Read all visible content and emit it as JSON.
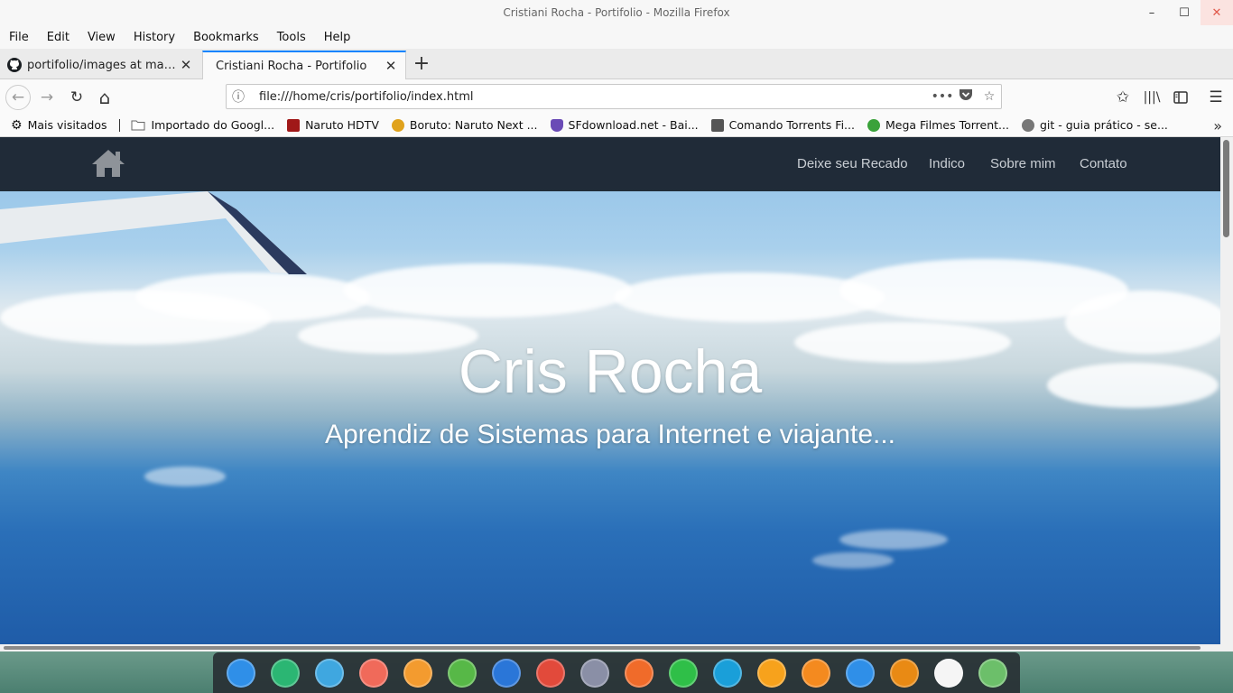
{
  "window": {
    "title": "Cristiani Rocha - Portifolio - Mozilla Firefox",
    "minimize_glyph": "–",
    "maximize_glyph": "☐",
    "close_glyph": "✕"
  },
  "menu": [
    "File",
    "Edit",
    "View",
    "History",
    "Bookmarks",
    "Tools",
    "Help"
  ],
  "tabs": [
    {
      "label": "portifolio/images at master · (",
      "icon": "github-icon",
      "active": false
    },
    {
      "label": "Cristiani Rocha - Portifolio",
      "icon": "",
      "active": true
    }
  ],
  "toolbar": {
    "url": "file:///home/cris/portifolio/index.html",
    "more_glyph": "•••",
    "back_glyph": "←",
    "forward_glyph": "→",
    "reload_glyph": "↻",
    "home_glyph": "⌂"
  },
  "bookmarks": [
    {
      "label": "Mais visitados",
      "icon": "gear-icon",
      "color": "#222222"
    },
    {
      "label": "Importado do Googl...",
      "icon": "folder-icon",
      "color": "#9e9e9e"
    },
    {
      "label": "Naruto HDTV",
      "icon": "naruto-favicon",
      "color": "#a01818"
    },
    {
      "label": "Boruto: Naruto Next ...",
      "icon": "boruto-favicon",
      "color": "#e0a21c"
    },
    {
      "label": "SFdownload.net - Bai...",
      "icon": "sfdownload-favicon",
      "color": "#6a4bb6"
    },
    {
      "label": "Comando Torrents Fi...",
      "icon": "comando-favicon",
      "color": "#555555"
    },
    {
      "label": "Mega Filmes Torrent...",
      "icon": "megafilmes-favicon",
      "color": "#3aa23a"
    },
    {
      "label": "git - guia prático - se...",
      "icon": "globe-icon",
      "color": "#777777"
    }
  ],
  "site": {
    "nav_links": [
      "Deixe seu Recado",
      "Indico",
      "Sobre mim",
      "Contato"
    ],
    "hero_title": "Cris Rocha",
    "hero_subtitle": "Aprendiz de Sistemas para Internet e viajante..."
  },
  "dock": [
    {
      "name": "launcher-icon",
      "color": "#2f8fe8"
    },
    {
      "name": "terminal-icon",
      "color": "#2bb673"
    },
    {
      "name": "file-manager-icon",
      "color": "#3fa7e0"
    },
    {
      "name": "screen-recorder-icon",
      "color": "#f06a5a"
    },
    {
      "name": "app-store-icon",
      "color": "#f39b2f"
    },
    {
      "name": "music-player-icon",
      "color": "#57b847"
    },
    {
      "name": "video-player-icon",
      "color": "#2a76d8"
    },
    {
      "name": "chrome-icon",
      "color": "#e24a3b"
    },
    {
      "name": "system-settings-icon",
      "color": "#8a8fa6"
    },
    {
      "name": "firefox-icon",
      "color": "#f06b2a"
    },
    {
      "name": "phone-icon",
      "color": "#2fbf48"
    },
    {
      "name": "whatsapp-icon",
      "color": "#1a9fd9"
    },
    {
      "name": "browser-orange-icon",
      "color": "#f7a21c"
    },
    {
      "name": "eject-icon",
      "color": "#f48a1f"
    },
    {
      "name": "wifi-icon",
      "color": "#2f8fe8"
    },
    {
      "name": "power-icon",
      "color": "#e98a14"
    },
    {
      "name": "clock-icon",
      "color": "#f5f5f5"
    },
    {
      "name": "trash-icon",
      "color": "#6cbf6a"
    }
  ]
}
